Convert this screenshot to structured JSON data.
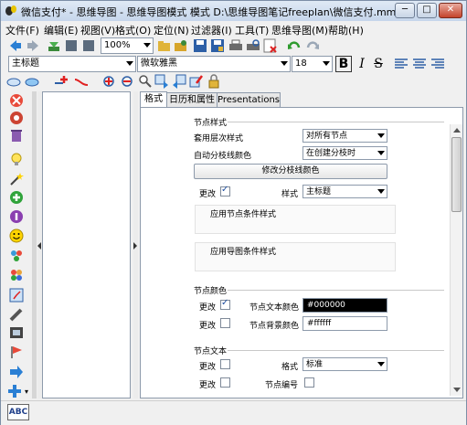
{
  "window": {
    "title": "微信支付* - 思维导图 - 思维导图模式 模式 D:\\思维导图笔记freeplan\\微信支付.mm",
    "minimize": "─",
    "maximize": "□",
    "close": "✕"
  },
  "menu": [
    "文件(F)",
    "编辑(E)",
    "视图(V)",
    "格式(O)",
    "定位(N)",
    "过滤器(I)",
    "工具(T)",
    "思维导图(M)",
    "帮助(H)"
  ],
  "toolbar": {
    "zoom": "100%",
    "style": "主标题",
    "font": "微软雅黑",
    "font_size": "18",
    "bold": "B",
    "italic": "I",
    "strike": "S"
  },
  "tabs": [
    "格式",
    "日历和属性",
    "Presentations"
  ],
  "format_panel": {
    "node_style_heading": "节点样式",
    "apply_level_style_label": "套用层次样式",
    "apply_level_style_value": "对所有节点",
    "auto_branch_color_label": "自动分枝线颜色",
    "auto_branch_color_value": "在创建分枝时",
    "modify_branch_color_button": "修改分枝线颜色",
    "change_label": "更改",
    "style_label": "样式",
    "style_value": "主标题",
    "applied_conditional_styles": "应用节点条件样式",
    "map_conditional_styles": "应用导图条件样式",
    "node_color_heading": "节点颜色",
    "text_color_label": "节点文本颜色",
    "text_color_value": "#000000",
    "bg_color_label": "节点背景颜色",
    "bg_color_value": "#ffffff",
    "node_text_heading": "节点文本",
    "format_label": "格式",
    "format_value": "标准",
    "numbering_label": "节点编号"
  },
  "checkbox_states": {
    "style_change": true,
    "text_color_change": true,
    "bg_color_change": false,
    "format_change": false,
    "numbering_change": false,
    "numbering": false
  },
  "statusbar": {
    "abc_icon": "ABC"
  }
}
